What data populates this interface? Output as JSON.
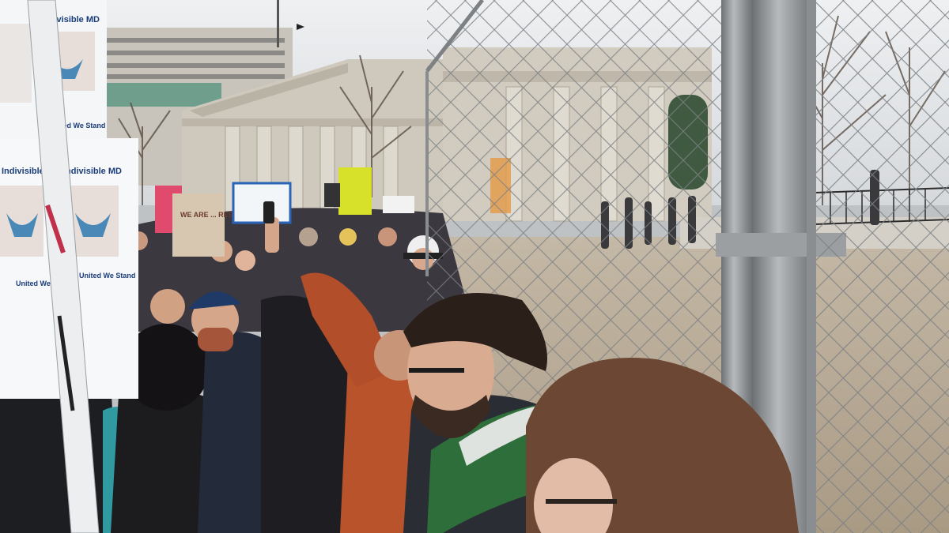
{
  "photo": {
    "subject": "protest crowd beside chain-link fence",
    "signs": {
      "poster_top_left_title": "Indivisible MD",
      "poster_top_left_slogan": "United We Stand",
      "poster_mid_left_title": "Indivisible MD",
      "poster_mid_right_title": "Indivisible MD",
      "poster_mid_left_slogan": "United We Stand",
      "poster_mid_right_slogan": "United We Stand",
      "crowd_sign_text": "WE ARE ... RESISTANCE"
    },
    "colors": {
      "sky": "#d9dcdf",
      "building": "#c9c3b7",
      "fence": "#8e9294",
      "ground": "#b8ab98",
      "orange_jacket": "#b9532c",
      "green_scarf": "#2e6e3a",
      "yellow_sign": "#d8e12a",
      "pink_sign": "#e04a6c"
    }
  }
}
